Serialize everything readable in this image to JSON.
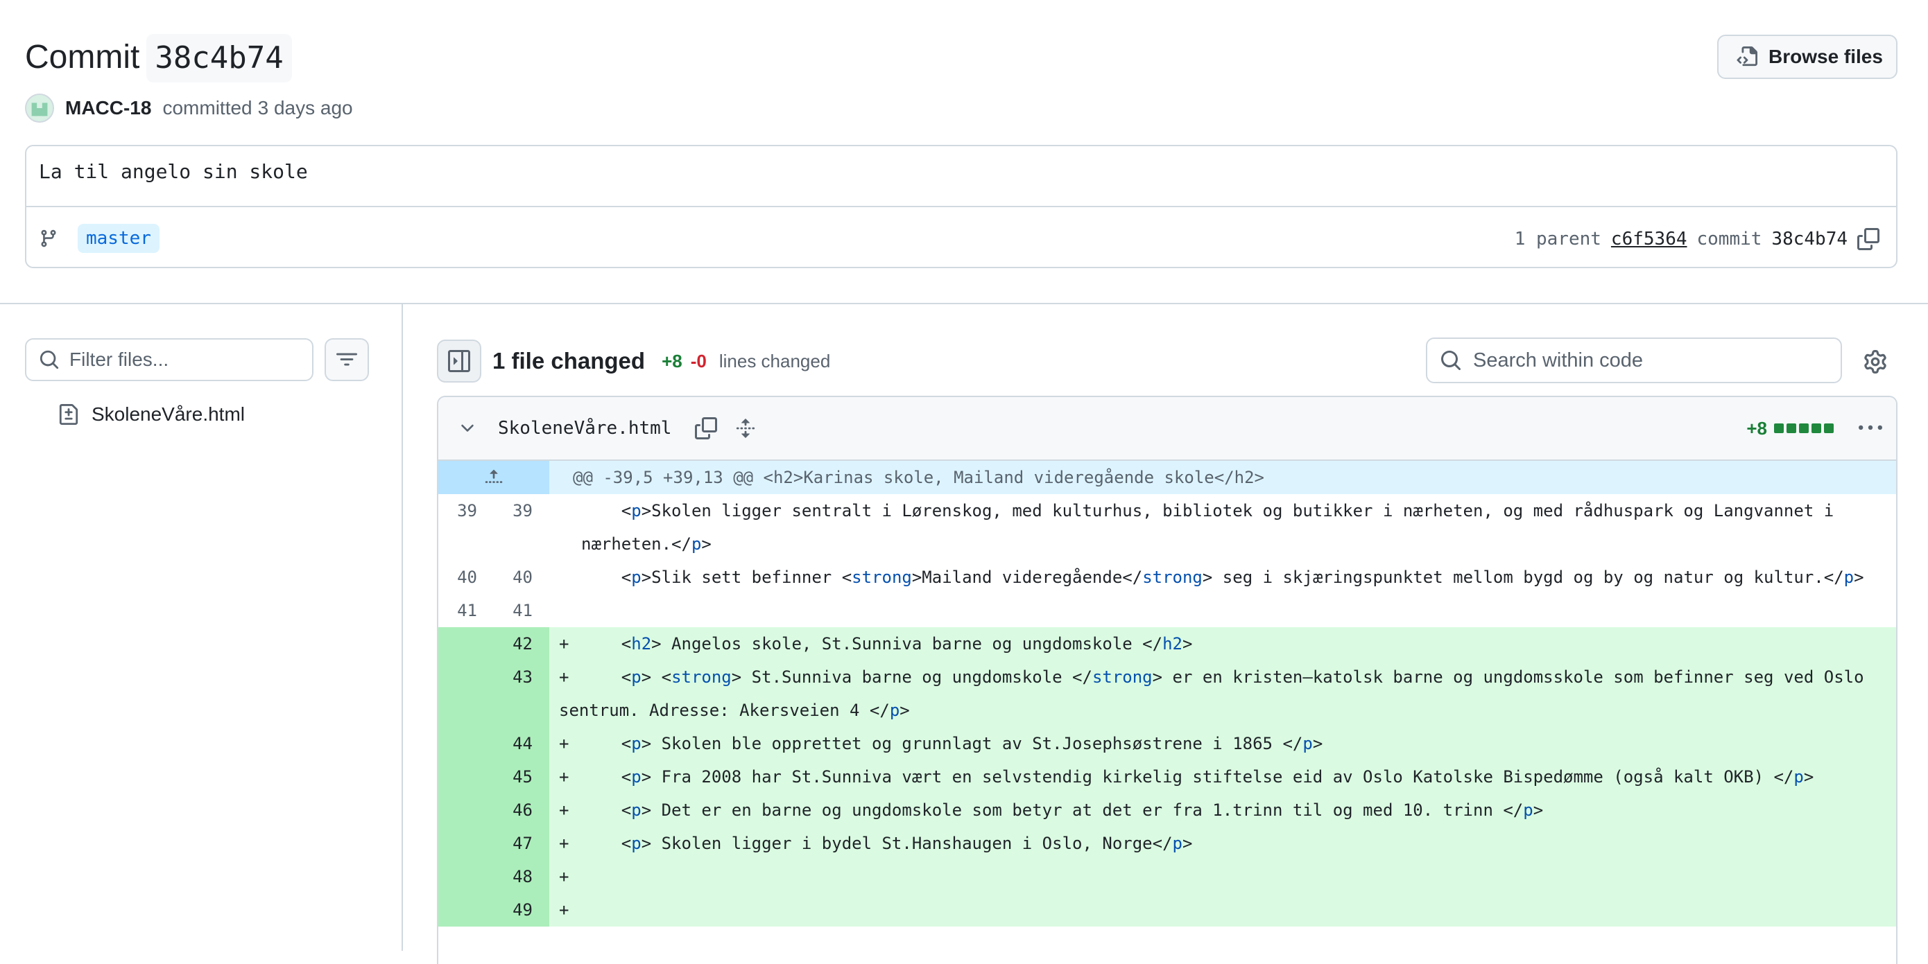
{
  "commit": {
    "title_prefix": "Commit",
    "sha": "38c4b74",
    "browse_label": "Browse files",
    "author": "MACC-18",
    "action": "committed",
    "time": "3 days ago",
    "message": "La til angelo sin skole",
    "branch": "master",
    "parent_count_label": "1 parent",
    "parent_sha": "c6f5364",
    "commit_label": "commit",
    "commit_sha": "38c4b74"
  },
  "sidebar": {
    "filter_placeholder": "Filter files...",
    "files": [
      {
        "name": "SkoleneVåre.html"
      }
    ]
  },
  "toolbar": {
    "files_changed": "1 file changed",
    "additions": "+8",
    "deletions": "-0",
    "lines_changed_label": "lines changed",
    "search_placeholder": "Search within code"
  },
  "diff": {
    "filename": "SkoleneVåre.html",
    "additions": "+8",
    "hunk": "@@ -39,5 +39,13 @@ <h2>Karinas skole, Mailand videregående skole</h2>",
    "lines": [
      {
        "type": "ctx",
        "old": "39",
        "new": "39",
        "text": "    <p>Skolen ligger sentralt i Lørenskog, med kulturhus, bibliotek og butikker i nærheten, og med rådhuspark og Langvannet i nærheten.</p>"
      },
      {
        "type": "ctx",
        "old": "40",
        "new": "40",
        "text": "    <p>Slik sett befinner <strong>Mailand videregående</strong> seg i skjæringspunktet mellom bygd og by og natur og kultur.</p>"
      },
      {
        "type": "ctx",
        "old": "41",
        "new": "41",
        "text": ""
      },
      {
        "type": "add",
        "old": "",
        "new": "42",
        "text": "    <h2> Angelos skole, St.Sunniva barne og ungdomskole </h2>"
      },
      {
        "type": "add",
        "old": "",
        "new": "43",
        "text": "    <p> <strong> St.Sunniva barne og ungdomskole </strong> er en kristen–katolsk barne og ungdomsskole som befinner seg ved Oslo sentrum. Adresse: Akersveien 4 </p>"
      },
      {
        "type": "add",
        "old": "",
        "new": "44",
        "text": "    <p> Skolen ble opprettet og grunnlagt av St.Josephsøstrene i 1865 </p>"
      },
      {
        "type": "add",
        "old": "",
        "new": "45",
        "text": "    <p> Fra 2008 har St.Sunniva vært en selvstendig kirkelig stiftelse eid av Oslo Katolske Bispedømme (også kalt OKB) </p>"
      },
      {
        "type": "add",
        "old": "",
        "new": "46",
        "text": "    <p> Det er en barne og ungdomskole som betyr at det er fra 1.trinn til og med 10. trinn </p>"
      },
      {
        "type": "add",
        "old": "",
        "new": "47",
        "text": "    <p> Skolen ligger i bydel St.Hanshaugen i Oslo, Norge</p>"
      },
      {
        "type": "add",
        "old": "",
        "new": "48",
        "text": ""
      },
      {
        "type": "add",
        "old": "",
        "new": "49",
        "text": ""
      }
    ]
  },
  "icons": {
    "browse": "file-code-icon",
    "branch": "git-branch-icon",
    "copy": "copy-icon",
    "search": "search-icon",
    "filter": "filter-icon",
    "sidebar_toggle": "sidebar-collapse-icon",
    "settings": "gear-icon",
    "expand": "unfold-icon",
    "chevron": "chevron-down-icon",
    "kebab": "kebab-horizontal-icon",
    "file": "file-diff-icon"
  },
  "colors": {
    "addition_bg": "#dafbe1",
    "addition_gutter": "#aceebb",
    "hunk_bg": "#ddf4ff",
    "accent": "#0969da",
    "add_text": "#1a7f37",
    "del_text": "#d1242f"
  }
}
